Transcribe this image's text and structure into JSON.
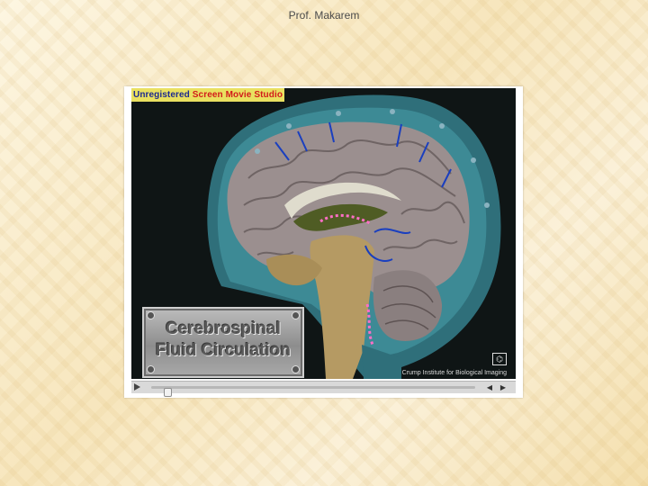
{
  "slide": {
    "author": "Prof. Makarem"
  },
  "video": {
    "watermark_prefix": "Unregistered",
    "watermark_rest": "Screen Movie Studio",
    "title_line1": "Cerebrospinal",
    "title_line2": "Fluid Circulation",
    "credit": "Crump Institute for Biological Imaging",
    "logo_glyph": "⌬"
  },
  "player": {
    "play_icon": "play-icon",
    "rewind_icon": "rewind-icon",
    "forward_icon": "forward-icon",
    "progress": 0
  },
  "colors": {
    "watermark_bg": "#e9e060",
    "brain": "#9b8f8f",
    "csf_teal": "#2f6f7a"
  }
}
